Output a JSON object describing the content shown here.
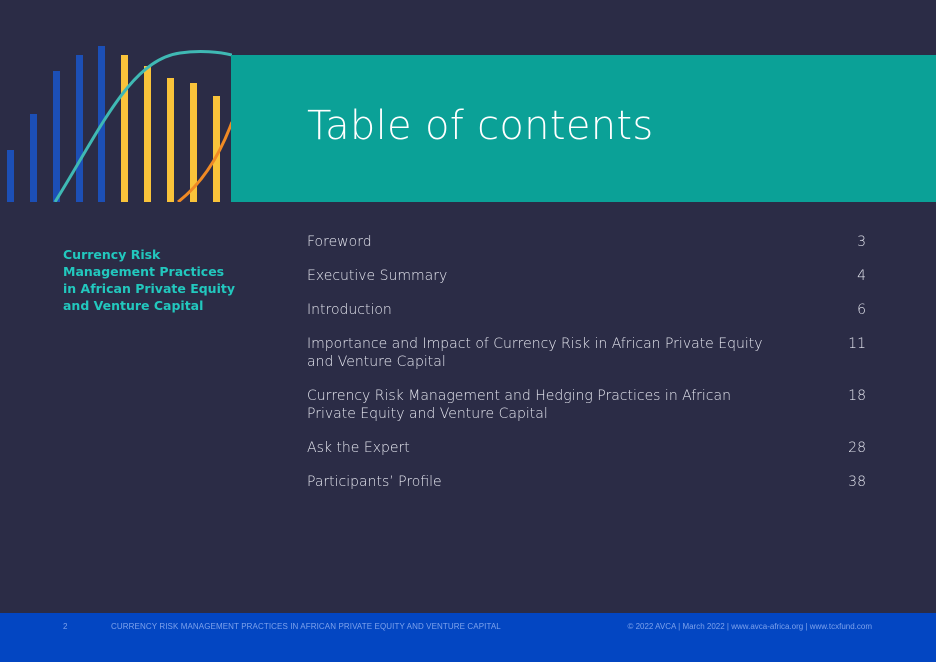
{
  "page": {
    "title": "Table of contents",
    "report_title": "Currency Risk Management Practices in African Private Equity and Venture Capital"
  },
  "toc": [
    {
      "title": "Foreword",
      "page": "3"
    },
    {
      "title": "Executive Summary",
      "page": "4"
    },
    {
      "title": "Introduction",
      "page": "6"
    },
    {
      "title": "Importance and Impact of Currency Risk in African Private Equity and Venture Capital",
      "page": "11"
    },
    {
      "title": "Currency Risk Management and Hedging Practices in African Private Equity and Venture Capital",
      "page": "18"
    },
    {
      "title": "Ask the Expert",
      "page": "28"
    },
    {
      "title": "Participants’ Profile",
      "page": "38"
    }
  ],
  "footer": {
    "page_number": "2",
    "document": "CURRENCY RISK MANAGEMENT PRACTICES IN AFRICAN PRIVATE EQUITY AND VENTURE CAPITAL",
    "credits": "© 2022 AVCA | March 2022 | www.avca-africa.org | www.tcxfund.com"
  },
  "colors": {
    "background": "#2b2c46",
    "teal_band": "#0ba197",
    "accent_teal": "#22c8be",
    "footer_blue": "#0346c2",
    "bar_blue": "#1c4fb6",
    "bar_yellow": "#f9c33a",
    "curve_teal": "#3fb9b4",
    "curve_orange": "#f08a24"
  },
  "icons": {
    "decor": "bar-chart-with-curves-graphic"
  }
}
